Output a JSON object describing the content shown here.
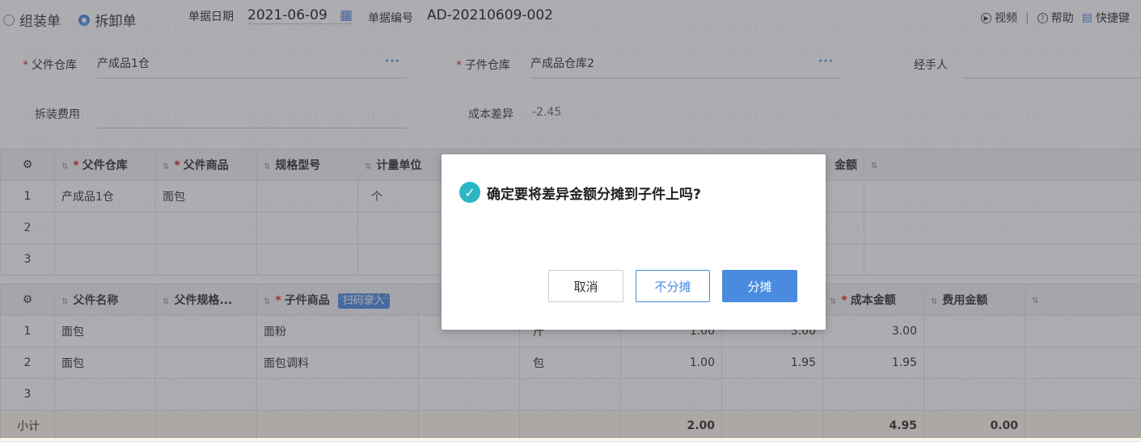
{
  "header": {
    "type_option_1": "组装单",
    "type_option_2": "拆卸单",
    "date_label": "单据日期",
    "date_value": "2021-06-09",
    "docno_label": "单据编号",
    "docno_value": "AD-20210609-002",
    "links": {
      "video": "视频",
      "help": "帮助",
      "shortcut": "快捷键"
    }
  },
  "form": {
    "parent_wh_label": "父件仓库",
    "parent_wh_value": "产成品1仓",
    "child_wh_label": "子件仓库",
    "child_wh_value": "产成品仓库2",
    "handler_label": "经手人",
    "fee_label": "拆装费用",
    "diff_label": "成本差异",
    "diff_value": "-2.45"
  },
  "table1": {
    "headers": [
      "父件仓库",
      "父件商品",
      "规格型号",
      "计量单位",
      "金额"
    ],
    "rows": [
      {
        "idx": "1",
        "wh": "产成品1仓",
        "goods": "面包",
        "unit": "个"
      },
      {
        "idx": "2"
      },
      {
        "idx": "3"
      }
    ]
  },
  "table2": {
    "headers": [
      "父件名称",
      "父件规格...",
      "子件商品",
      "成本金额",
      "费用金额"
    ],
    "scan_label": "扫码录入",
    "rows": [
      {
        "idx": "1",
        "parent": "面包",
        "child": "面粉",
        "unit": "斤",
        "qty": "1.00",
        "price": "3.00",
        "cost": "3.00"
      },
      {
        "idx": "2",
        "parent": "面包",
        "child": "面包调料",
        "unit": "包",
        "qty": "1.00",
        "price": "1.95",
        "cost": "1.95"
      },
      {
        "idx": "3"
      }
    ],
    "sum": {
      "label": "小计",
      "qty": "2.00",
      "cost": "4.95",
      "fee": "0.00"
    }
  },
  "watermark": {
    "phone": "电话：400-665-0028",
    "site": "网址：www.chanjet.net"
  },
  "dialog": {
    "message": "确定要将差异金额分摊到子件上吗?",
    "cancel": "取消",
    "no_split": "不分摊",
    "split": "分摊"
  },
  "colors": {
    "accent": "#4a8be0",
    "check": "#2db7c4"
  }
}
